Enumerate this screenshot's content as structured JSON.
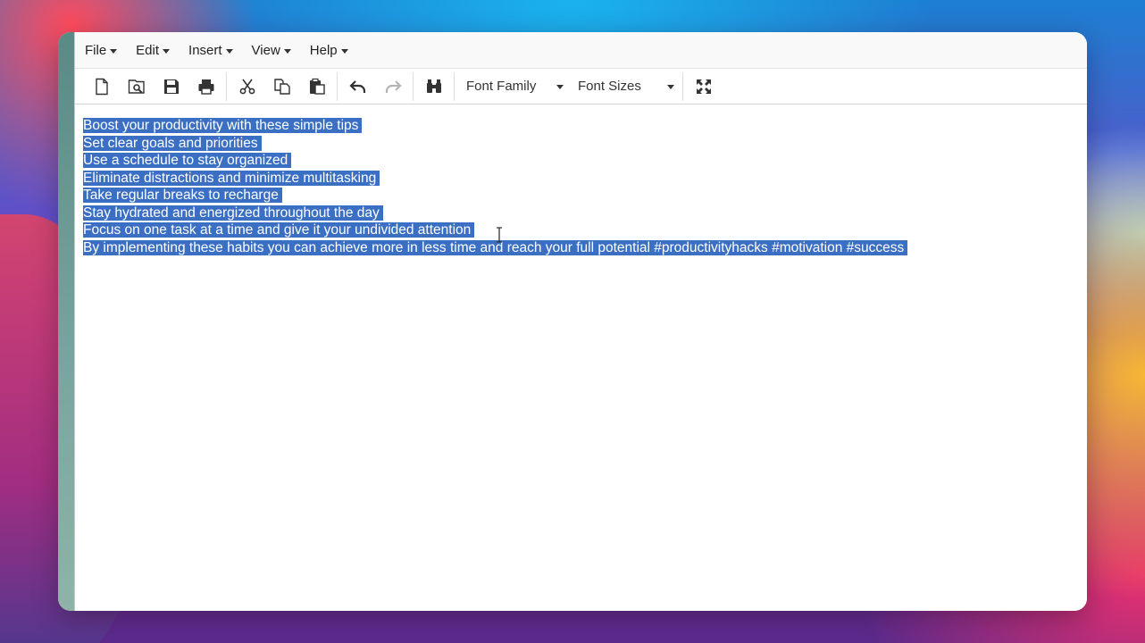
{
  "menubar": {
    "items": [
      {
        "label": "File",
        "name": "menu-file"
      },
      {
        "label": "Edit",
        "name": "menu-edit"
      },
      {
        "label": "Insert",
        "name": "menu-insert"
      },
      {
        "label": "View",
        "name": "menu-view"
      },
      {
        "label": "Help",
        "name": "menu-help"
      }
    ]
  },
  "toolbar": {
    "icons": [
      "new-document-icon",
      "preview-icon",
      "save-icon",
      "print-icon",
      "cut-icon",
      "copy-icon",
      "paste-icon",
      "undo-icon",
      "redo-icon",
      "find-icon",
      "fullscreen-icon"
    ],
    "font_family_label": "Font Family",
    "font_sizes_label": "Font Sizes"
  },
  "document": {
    "lines": [
      "Boost your productivity with these simple tips",
      "Set clear goals and priorities",
      "Use a schedule to stay organized",
      "Eliminate distractions and minimize multitasking",
      "Take regular breaks to recharge",
      "Stay hydrated and energized throughout the day",
      "Focus on one task at a time and give it your undivided attention",
      "By implementing these habits you can achieve more in less time and reach your full potential #productivityhacks #motivation #success"
    ]
  },
  "colors": {
    "selection": "#3a6fc4",
    "menubar_bg": "#f9f9f9"
  }
}
